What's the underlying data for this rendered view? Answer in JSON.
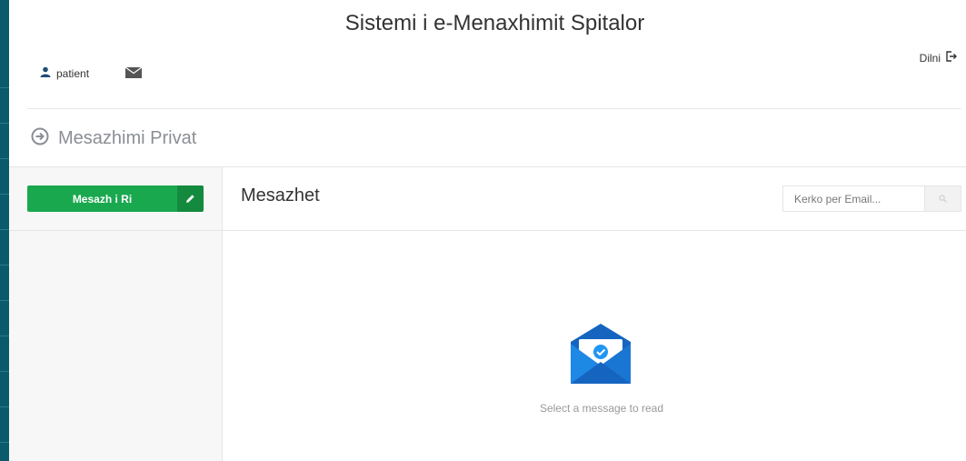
{
  "app": {
    "title": "Sistemi i e-Menaxhimit Spitalor"
  },
  "header": {
    "user_label": "patient",
    "logout_label": "Dilni"
  },
  "section": {
    "title": "Mesazhimi Privat"
  },
  "sidebar": {
    "compose_label": "Mesazh i Ri"
  },
  "content": {
    "title": "Mesazhet",
    "search_placeholder": "Kerko per Email...",
    "empty_text": "Select a message to read"
  },
  "colors": {
    "rail": "#0b5a6b",
    "accent": "#1aa84f",
    "accent_dark": "#148a3f",
    "envelope_blue": "#1565c0"
  },
  "icons": [
    "user-icon",
    "envelope-icon",
    "logout-icon",
    "arrow-right-circle-icon",
    "pencil-icon",
    "search-icon",
    "open-envelope-icon"
  ]
}
